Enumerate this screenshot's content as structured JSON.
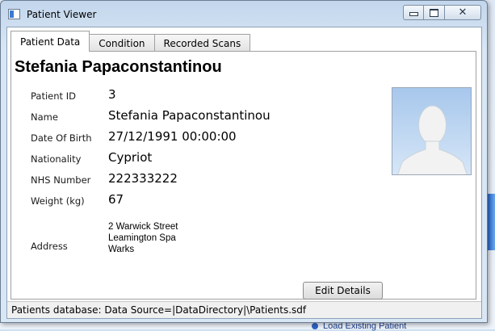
{
  "window": {
    "title": "Patient Viewer",
    "controls": {
      "minimize": "minimize",
      "maximize": "maximize",
      "close": "✕"
    }
  },
  "tabs": [
    {
      "label": "Patient Data",
      "active": true
    },
    {
      "label": "Condition",
      "active": false
    },
    {
      "label": "Recorded Scans",
      "active": false
    }
  ],
  "patient": {
    "heading": "Stefania Papaconstantinou",
    "fields": [
      {
        "label": "Patient ID",
        "value": "3"
      },
      {
        "label": "Name",
        "value": "Stefania Papaconstantinou"
      },
      {
        "label": "Date Of Birth",
        "value": "27/12/1991 00:00:00"
      },
      {
        "label": "Nationality",
        "value": "Cypriot"
      },
      {
        "label": "NHS Number",
        "value": "222333222"
      },
      {
        "label": "Weight (kg)",
        "value": "67"
      }
    ],
    "address_label": "Address",
    "address_lines": [
      "2 Warwick Street",
      "Leamington Spa",
      "Warks"
    ],
    "photo_icon": "person-silhouette-icon"
  },
  "actions": {
    "edit_details": "Edit Details"
  },
  "status": {
    "text": "Patients database: Data Source=|DataDirectory|\\Patients.sdf"
  },
  "background": {
    "link_text": "Load Existing Patient"
  },
  "colors": {
    "accent": "#3a7bd5",
    "photo_bg": "#a7c7ec",
    "silhouette": "#f2f2f2"
  }
}
